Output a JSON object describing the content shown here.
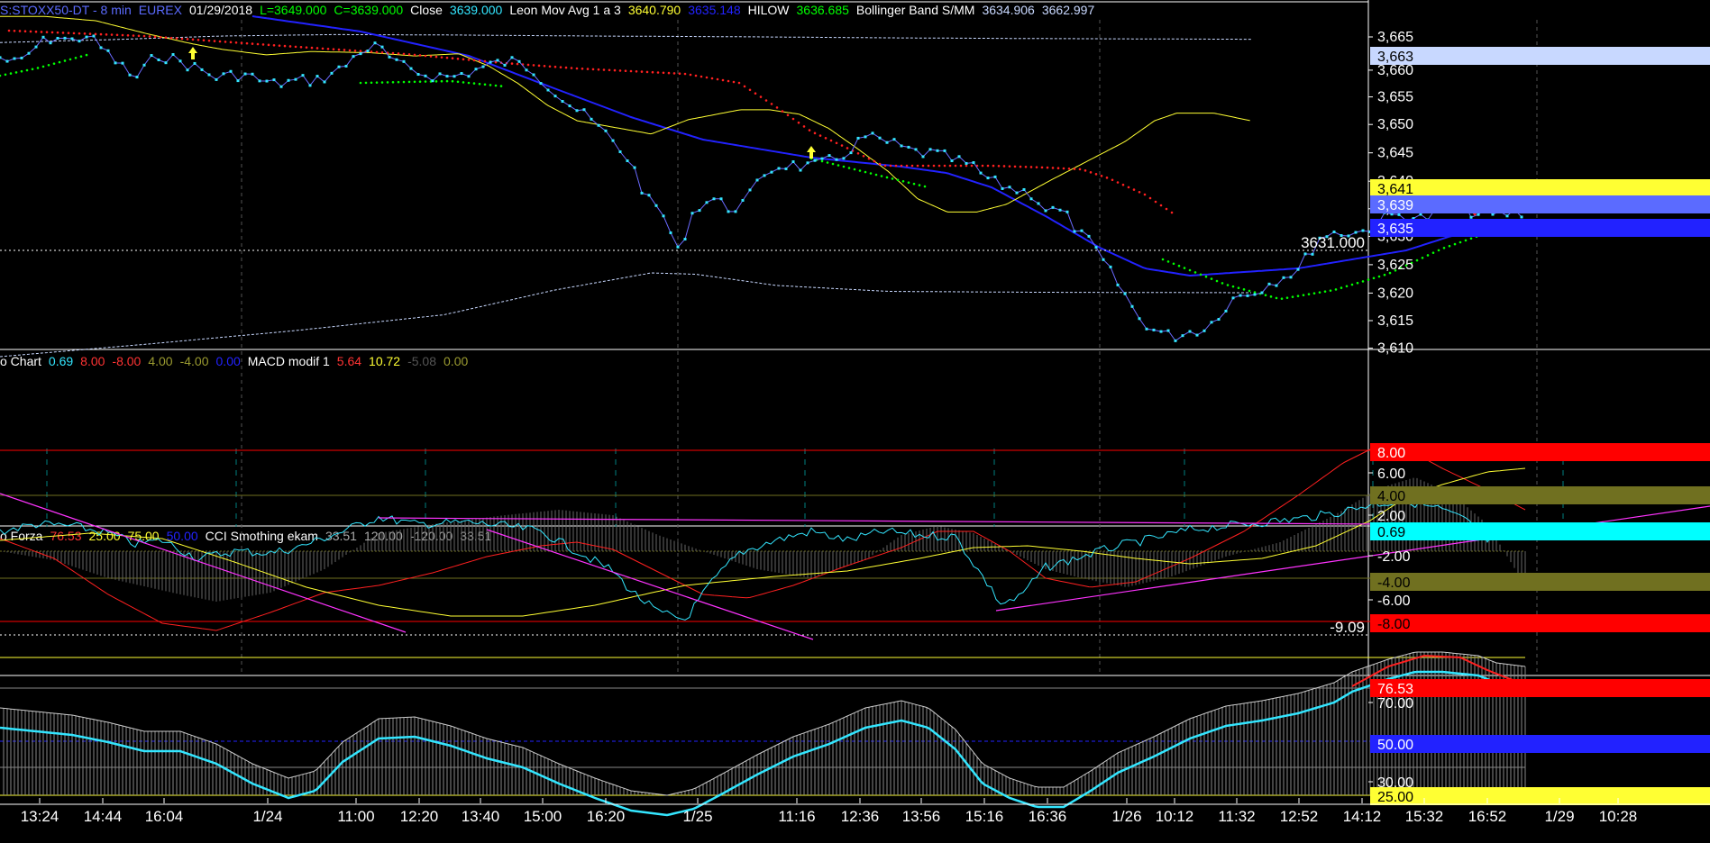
{
  "main_header": [
    {
      "text": "S:STOXX50-DT - 8 min",
      "color": "#5b6bff"
    },
    {
      "text": "EUREX",
      "color": "#5b6bff"
    },
    {
      "text": "01/29/2018",
      "color": "#ffffff"
    },
    {
      "text": "L=3649.000",
      "color": "#00ff00"
    },
    {
      "text": "C=3639.000",
      "color": "#00ff00"
    },
    {
      "text": "Close",
      "color": "#ffffff"
    },
    {
      "text": "3639.000",
      "color": "#33e6ff"
    },
    {
      "text": "Leon Mov Avg 1 a 3",
      "color": "#ffffff"
    },
    {
      "text": "3640.790",
      "color": "#ffff33"
    },
    {
      "text": "3635.148",
      "color": "#2222ff"
    },
    {
      "text": "HILOW",
      "color": "#ffffff"
    },
    {
      "text": "3636.685",
      "color": "#00ff00"
    },
    {
      "text": "Bollinger Band S/MM",
      "color": "#ffffff"
    },
    {
      "text": "3634.906",
      "color": "#c8d8ff"
    },
    {
      "text": "3662.997",
      "color": "#c8d8ff"
    }
  ],
  "macd_header": [
    {
      "text": "o Chart",
      "color": "#ffffff"
    },
    {
      "text": "0.69",
      "color": "#33e6ff"
    },
    {
      "text": "8.00",
      "color": "#ff3333"
    },
    {
      "text": "-8.00",
      "color": "#ff3333"
    },
    {
      "text": "4.00",
      "color": "#9a9a30"
    },
    {
      "text": "-4.00",
      "color": "#9a9a30"
    },
    {
      "text": "0.00",
      "color": "#2222ff"
    },
    {
      "text": "MACD modif 1",
      "color": "#ffffff"
    },
    {
      "text": "5.64",
      "color": "#ff3333"
    },
    {
      "text": "10.72",
      "color": "#ffff33"
    },
    {
      "text": "-5.08",
      "color": "#555555"
    },
    {
      "text": "0.00",
      "color": "#9a9a30"
    }
  ],
  "cci_header": [
    {
      "text": "o Forza",
      "color": "#ffffff"
    },
    {
      "text": "76.53",
      "color": "#ff3333"
    },
    {
      "text": "25.00",
      "color": "#ffff33"
    },
    {
      "text": "75.00",
      "color": "#ffff33"
    },
    {
      "text": "50.00",
      "color": "#2222ff"
    },
    {
      "text": "CCI Smothing ekam",
      "color": "#ffffff"
    },
    {
      "text": "33.51",
      "color": "#aaaaaa"
    },
    {
      "text": "120.00",
      "color": "#aaaaaa"
    },
    {
      "text": "-120.00",
      "color": "#aaaaaa"
    },
    {
      "text": "33.51",
      "color": "#aaaaaa"
    }
  ],
  "price_axis": {
    "ticks": [
      "3,665",
      "3,660",
      "3,655",
      "3,650",
      "3,645",
      "3,640",
      "3,635",
      "3,630",
      "3,625",
      "3,620",
      "3,615",
      "3,610"
    ],
    "tick_values": [
      3665,
      3660,
      3655,
      3650,
      3645,
      3640,
      3635,
      3630,
      3625,
      3620,
      3615,
      3610
    ],
    "range": [
      3605,
      3667
    ],
    "markers": [
      {
        "text": "3,663",
        "value": 3663,
        "bg": "#c8d8ff",
        "fg": "#000000"
      },
      {
        "text": "3,641",
        "value": 3641,
        "bg": "#ffff33",
        "fg": "#000000"
      },
      {
        "text": "3,639",
        "value": 3639,
        "bg": "#5b6bff",
        "fg": "#ffffff"
      },
      {
        "text": "3,635",
        "value": 3635,
        "bg": "#2222ff",
        "fg": "#ffffff"
      }
    ],
    "reference_line": {
      "label": "3631.000",
      "value": 3631
    }
  },
  "macd_axis": {
    "ticks": [
      "6.00",
      "2.00",
      "-2.00",
      "-6.00"
    ],
    "tick_values": [
      6,
      2,
      -2,
      -6
    ],
    "range": [
      -10,
      10
    ],
    "markers": [
      {
        "text": "8.00",
        "value": 8,
        "bg": "#ff0000",
        "fg": "#ffffff"
      },
      {
        "text": "4.00",
        "value": 4,
        "bg": "#707020",
        "fg": "#000000"
      },
      {
        "text": "0.69",
        "value": 0.69,
        "bg": "#00ffff",
        "fg": "#000000"
      },
      {
        "text": "-4.00",
        "value": -4,
        "bg": "#707020",
        "fg": "#000000"
      },
      {
        "text": "-8.00",
        "value": -8,
        "bg": "#ff0000",
        "fg": "#000000"
      }
    ],
    "reference_line": {
      "label": "-9.09",
      "value": -9.09
    }
  },
  "cci_axis": {
    "ticks": [
      "70.00",
      "30.00"
    ],
    "tick_values": [
      70,
      30
    ],
    "range": [
      18,
      100
    ],
    "markers": [
      {
        "text": "76.53",
        "value": 76.53,
        "bg": "#ff0000",
        "fg": "#ffffff"
      },
      {
        "text": "50.00",
        "value": 50,
        "bg": "#2222ff",
        "fg": "#ffffff"
      },
      {
        "text": "25.00",
        "value": 25,
        "bg": "#ffff33",
        "fg": "#000000"
      }
    ]
  },
  "time_axis": {
    "labels": [
      "13:24",
      "14:44",
      "16:04",
      "1/24",
      "11:00",
      "12:20",
      "13:40",
      "15:00",
      "16:20",
      "1/25",
      "11:16",
      "12:36",
      "13:56",
      "15:16",
      "16:36",
      "1/26",
      "10:12",
      "11:32",
      "12:52",
      "14:12",
      "15:32",
      "16:52",
      "1/29",
      "10:28"
    ],
    "day_dividers": [
      "1/24",
      "1/25",
      "1/26",
      "1/29"
    ]
  },
  "colors": {
    "close": "#33e6ff",
    "close_line": "#6a6aff",
    "ma_fast": "#ffff33",
    "ma_slow": "#2222ff",
    "hilow_up": "#00ff00",
    "hilow_down": "#ff2020",
    "bollinger": "#c8d8ff",
    "macd_signal": "#33e6ff",
    "macd_red": "#ff2020",
    "macd_yellow": "#ffff33",
    "trendline": "#ff33ff",
    "cci": "#33e6ff",
    "cci_white": "#cccccc",
    "arrow_up": "#ffff33",
    "arrow_down": "#ff2020"
  }
}
